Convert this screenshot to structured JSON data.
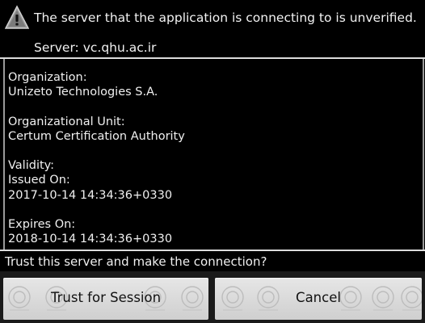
{
  "dialog": {
    "warning_title": "The server that the application is connecting to is unverified.",
    "server_line": "Server: vc.qhu.ac.ir",
    "certificate_lines": [
      "Organization:",
      "Unizeto Technologies S.A.",
      "",
      "Organizational Unit:",
      "Certum Certification Authority",
      "",
      "Validity:",
      "Issued On:",
      "2017-10-14 14:34:36+0330",
      "",
      "Expires On:",
      "2018-10-14 14:34:36+0330"
    ],
    "question": "Trust this server and make the connection?",
    "trust_button": "Trust for Session",
    "cancel_button": "Cancel"
  },
  "icons": {
    "warning": "warning-triangle-icon",
    "watermark": "university-seal-watermark"
  },
  "colors": {
    "background": "#000000",
    "text": "#f0f0f0",
    "divider": "#dcdcdc",
    "button_face": "#dcdcdc",
    "button_text": "#111111"
  }
}
